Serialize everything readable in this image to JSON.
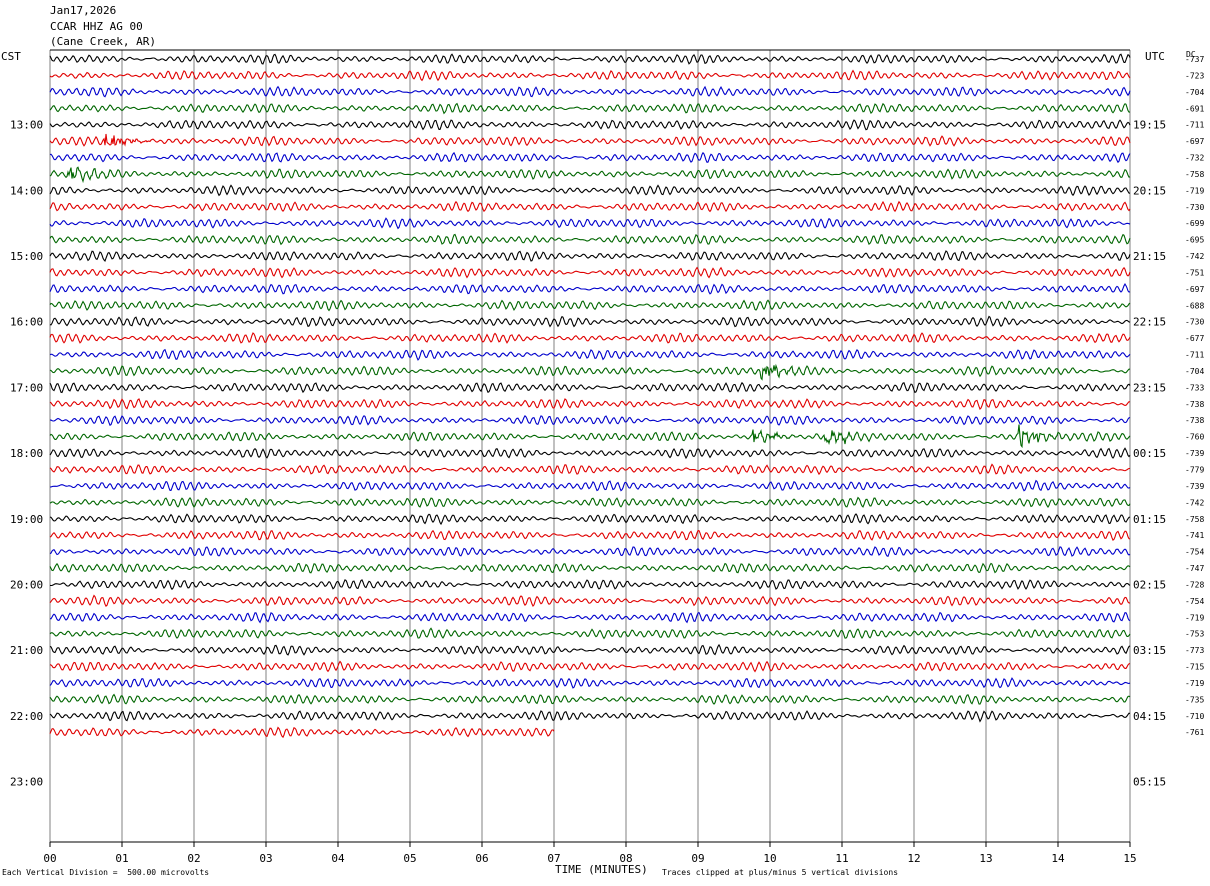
{
  "header": {
    "date": "Jan17,2026",
    "station": "CCAR HHZ AG 00",
    "location": "(Cane Creek, AR)"
  },
  "left_tz": "CST",
  "right_tz": "UTC",
  "dc_label": "DC",
  "footer": {
    "scale_note": "Each Vertical Division =  500.00 microvolts",
    "x_title": "TIME (MINUTES)",
    "clip_note": "Traces clipped at plus/minus 5 vertical divisions"
  },
  "colors": {
    "trace_cycle": [
      "#000000",
      "#e00000",
      "#0000cc",
      "#006600"
    ],
    "grid": "#808080"
  },
  "chart_data": {
    "type": "line",
    "title": "",
    "xlabel": "TIME (MINUTES)",
    "xlim": [
      0,
      15
    ],
    "x_ticks": [
      "00",
      "01",
      "02",
      "03",
      "04",
      "05",
      "06",
      "07",
      "08",
      "09",
      "10",
      "11",
      "12",
      "13",
      "14",
      "15"
    ],
    "row_minutes": 15,
    "total_rows": 48,
    "left_hour_labels": [
      {
        "row": 4,
        "label": "13:00"
      },
      {
        "row": 8,
        "label": "14:00"
      },
      {
        "row": 12,
        "label": "15:00"
      },
      {
        "row": 16,
        "label": "16:00"
      },
      {
        "row": 20,
        "label": "17:00"
      },
      {
        "row": 24,
        "label": "18:00"
      },
      {
        "row": 28,
        "label": "19:00"
      },
      {
        "row": 32,
        "label": "20:00"
      },
      {
        "row": 36,
        "label": "21:00"
      },
      {
        "row": 40,
        "label": "22:00"
      },
      {
        "row": 44,
        "label": "23:00"
      }
    ],
    "right_hour_labels": [
      {
        "row": 4,
        "label": "19:15"
      },
      {
        "row": 8,
        "label": "20:15"
      },
      {
        "row": 12,
        "label": "21:15"
      },
      {
        "row": 16,
        "label": "22:15"
      },
      {
        "row": 20,
        "label": "23:15"
      },
      {
        "row": 24,
        "label": "00:15"
      },
      {
        "row": 28,
        "label": "01:15"
      },
      {
        "row": 32,
        "label": "02:15"
      },
      {
        "row": 36,
        "label": "03:15"
      },
      {
        "row": 40,
        "label": "04:15"
      },
      {
        "row": 44,
        "label": "05:15"
      }
    ],
    "dc_offsets": [
      "-737",
      "-723",
      "-704",
      "-691",
      "-711",
      "-697",
      "-732",
      "-758",
      "-719",
      "-730",
      "-699",
      "-695",
      "-742",
      "-751",
      "-697",
      "-688",
      "-730",
      "-677",
      "-711",
      "-704",
      "-733",
      "-738",
      "-738",
      "-760",
      "-739",
      "-779",
      "-739",
      "-742",
      "-758",
      "-741",
      "-754",
      "-747",
      "-728",
      "-754",
      "-719",
      "-753",
      "-773",
      "-715",
      "-719",
      "-735",
      "-710",
      "-761"
    ],
    "last_row_end_minute": 7,
    "events": [
      {
        "row": 5,
        "minute": 0.8,
        "amp": 1.4
      },
      {
        "row": 7,
        "minute": 0.3,
        "amp": 1.5
      },
      {
        "row": 19,
        "minute": 9.9,
        "amp": 1.6
      },
      {
        "row": 23,
        "minute": 9.8,
        "amp": 1.3
      },
      {
        "row": 23,
        "minute": 10.8,
        "amp": 1.3
      },
      {
        "row": 23,
        "minute": 13.5,
        "amp": 1.9
      }
    ]
  }
}
